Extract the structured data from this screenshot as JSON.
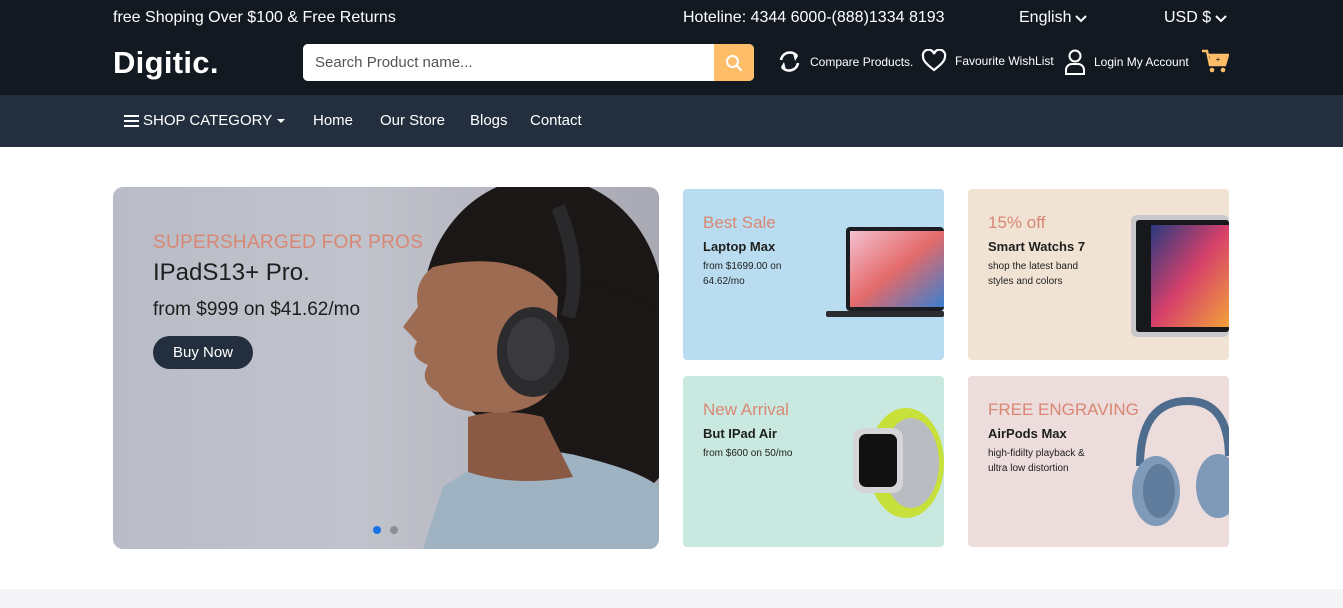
{
  "header": {
    "promo": "free Shoping Over $100 & Free Returns",
    "hotline": "Hoteline: 4344 6000-(888)1334 8193",
    "language": "English",
    "currency": "USD $",
    "logo": "Digitic.",
    "search": {
      "placeholder": "Search Product name..."
    },
    "links": {
      "compare": "Compare Products.",
      "wishlist": "Favourite WishList",
      "account": "Login My Account"
    }
  },
  "nav": {
    "category": "SHOP CATEGORY",
    "items": [
      "Home",
      "Our Store",
      "Blogs",
      "Contact"
    ]
  },
  "main_banner": {
    "eyebrow": "SUPERSHARGED FOR PROS",
    "title": "IPadS13+ Pro.",
    "subtitle": "from $999 on $41.62/mo",
    "button": "Buy Now",
    "slides": 2,
    "active_slide": 1
  },
  "small_banners": [
    {
      "eyebrow": "Best Sale",
      "title": "Laptop Max",
      "desc": "from $1699.00 on 64.62/mo",
      "bg": "#b9dcf0"
    },
    {
      "eyebrow": "15% off",
      "title": "Smart Watchs 7",
      "desc": "shop the latest band styles and colors",
      "bg": "#f0e3d4"
    },
    {
      "eyebrow": "New Arrival",
      "title": "But IPad Air",
      "desc": "from $600 on 50/mo",
      "bg": "#c9e9e0"
    },
    {
      "eyebrow": "FREE ENGRAVING",
      "title": "AirPods Max",
      "desc": "high-fidilty playback & ultra low distortion",
      "bg": "#ecdcdc"
    }
  ],
  "colors": {
    "topbar": "#131921",
    "navbar": "#232f3e",
    "accent": "#febd69",
    "eyebrow": "#d98773"
  }
}
